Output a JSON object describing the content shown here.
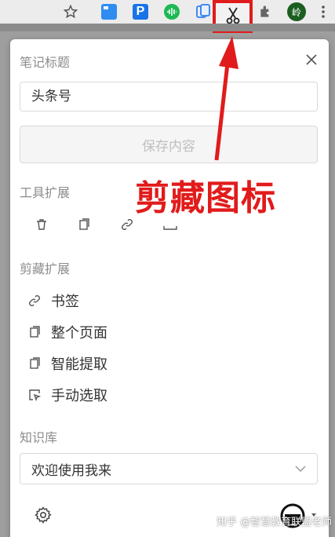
{
  "browser_toolbar": {
    "icons": [
      "star-icon",
      "ext-blue-icon",
      "ext-p-icon",
      "ext-green-wave-icon",
      "ext-doc-icon",
      "ext-scissors-icon",
      "puzzle-icon",
      "avatar-icon",
      "more-icon"
    ],
    "ext_p_letter": "P",
    "avatar_text": "岭"
  },
  "panel": {
    "note_title_label": "笔记标题",
    "title_value": "头条号",
    "save_button": "保存内容",
    "tools_label": "工具扩展",
    "clip_label": "剪藏扩展",
    "clip_items": [
      {
        "icon": "link-icon",
        "label": "书签"
      },
      {
        "icon": "copy-icon",
        "label": "整个页面"
      },
      {
        "icon": "copy-icon",
        "label": "智能提取"
      },
      {
        "icon": "select-icon",
        "label": "手动选取"
      }
    ],
    "kb_label": "知识库",
    "kb_value": "欢迎使用我来"
  },
  "annotation": {
    "text": "剪藏图标",
    "color": "#e11b1b"
  },
  "watermark": "知乎 @智慧教育联盟老师",
  "colors": {
    "accent_red": "#e11b1b",
    "muted": "#8c8c8c",
    "disabled_bg": "#f5f5f5"
  }
}
